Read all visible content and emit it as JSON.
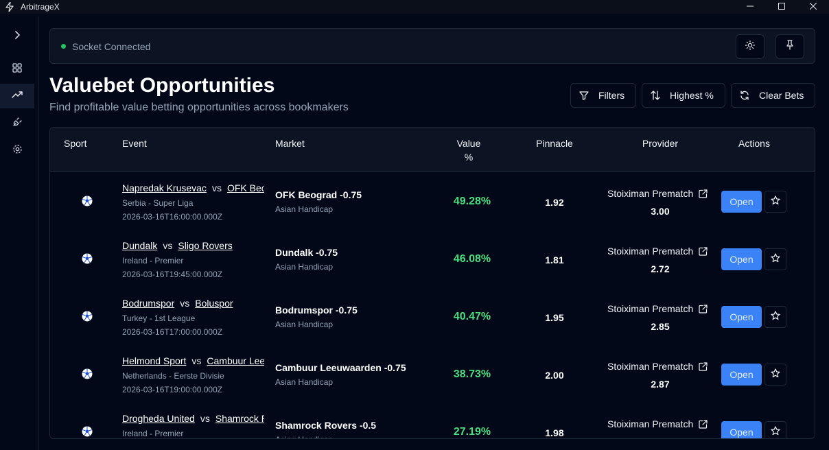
{
  "window": {
    "title": "ArbitrageX",
    "icon": "lightning-icon",
    "controls": [
      "minimize-icon",
      "maximize-icon",
      "close-icon"
    ]
  },
  "sidebar": {
    "items": [
      {
        "icon": "chevron-right-icon",
        "active": false
      },
      {
        "icon": "dashboard-icon",
        "active": false
      },
      {
        "icon": "trending-up-icon",
        "active": true
      },
      {
        "icon": "plug-icon",
        "active": false
      },
      {
        "icon": "gear-icon",
        "active": false
      }
    ]
  },
  "status": {
    "text": "Socket Connected",
    "color": "#22c55e",
    "buttons": [
      "sun-icon",
      "pin-icon"
    ]
  },
  "header": {
    "title": "Valuebet Opportunities",
    "subtitle": "Find profitable value betting opportunities across bookmakers",
    "filters_label": "Filters",
    "sort_label": "Highest %",
    "clear_label": "Clear Bets"
  },
  "table": {
    "columns": {
      "sport": "Sport",
      "event": "Event",
      "market": "Market",
      "value_line1": "Value",
      "value_line2": "%",
      "pinnacle": "Pinnacle",
      "provider": "Provider",
      "actions": "Actions"
    },
    "open_label": "Open",
    "rows": [
      {
        "sport_icon": "soccer-ball-icon",
        "home": "Napredak Krusevac",
        "vs": "vs",
        "away": "OFK Beograd",
        "league": "Serbia - Super Liga",
        "time": "2026-03-16T16:00:00.000Z",
        "market": "OFK Beograd -0.75",
        "market_type": "Asian Handicap",
        "value": "49.28%",
        "pinnacle": "1.92",
        "provider": "Stoiximan Prematch",
        "odds": "3.00"
      },
      {
        "sport_icon": "soccer-ball-icon",
        "home": "Dundalk",
        "vs": "vs",
        "away": "Sligo Rovers",
        "league": "Ireland - Premier",
        "time": "2026-03-16T19:45:00.000Z",
        "market": "Dundalk -0.75",
        "market_type": "Asian Handicap",
        "value": "46.08%",
        "pinnacle": "1.81",
        "provider": "Stoiximan Prematch",
        "odds": "2.72"
      },
      {
        "sport_icon": "soccer-ball-icon",
        "home": "Bodrumspor",
        "vs": "vs",
        "away": "Boluspor",
        "league": "Turkey - 1st League",
        "time": "2026-03-16T17:00:00.000Z",
        "market": "Bodrumspor -0.75",
        "market_type": "Asian Handicap",
        "value": "40.47%",
        "pinnacle": "1.95",
        "provider": "Stoiximan Prematch",
        "odds": "2.85"
      },
      {
        "sport_icon": "soccer-ball-icon",
        "home": "Helmond Sport",
        "vs": "vs",
        "away": "Cambuur Leeuwaarden",
        "league": "Netherlands - Eerste Divisie",
        "time": "2026-03-16T19:00:00.000Z",
        "market": "Cambuur Leeuwaarden -0.75",
        "market_type": "Asian Handicap",
        "value": "38.73%",
        "pinnacle": "2.00",
        "provider": "Stoiximan Prematch",
        "odds": "2.87"
      },
      {
        "sport_icon": "soccer-ball-icon",
        "home": "Drogheda United",
        "vs": "vs",
        "away": "Shamrock Rovers",
        "league": "Ireland - Premier",
        "time": "",
        "market": "Shamrock Rovers -0.5",
        "market_type": "Asian Handicap",
        "value": "27.19%",
        "pinnacle": "1.98",
        "provider": "Stoiximan Prematch",
        "odds": ""
      }
    ]
  }
}
